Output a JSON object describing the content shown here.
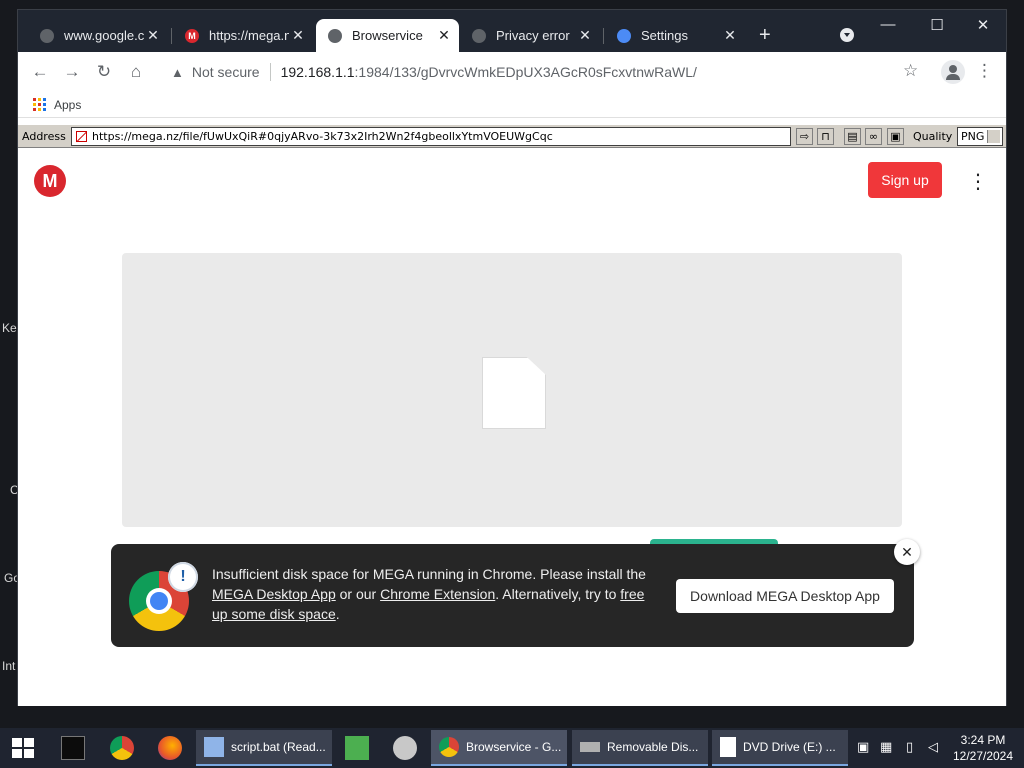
{
  "desktop": {
    "labels": [
      "Ke",
      "C",
      "Go",
      "Int"
    ]
  },
  "browser": {
    "tabs": [
      {
        "title": "www.google.co",
        "icon": "globe-icon",
        "active": false
      },
      {
        "title": "https://mega.n",
        "icon": "mega-favicon",
        "active": false
      },
      {
        "title": "Browservice",
        "icon": "globe-icon",
        "active": true
      },
      {
        "title": "Privacy error",
        "icon": "globe-icon",
        "active": false
      },
      {
        "title": "Settings",
        "icon": "gear-icon",
        "active": false
      }
    ],
    "new_tab_label": "+",
    "window_controls": {
      "minimize": "—",
      "maximize": "☐",
      "close": "✕"
    },
    "address": {
      "security_label": "Not secure",
      "host": "192.168.1.1",
      "path": ":1984/133/gDvrvcWmkEDpUX3AGcR0sFcxvtnwRaWL/"
    },
    "bookmarks": {
      "apps_label": "Apps"
    }
  },
  "browservice_bar": {
    "address_label": "Address",
    "url": "https://mega.nz/file/fUwUxQiR#0qjyARvo-3k73x2Irh2Wn2f4gbeollxYtmVOEUWgCqc",
    "quality_label": "Quality",
    "quality_value": "PNG"
  },
  "page": {
    "logo_letter": "M",
    "signup_label": "Sign up",
    "menu_glyph": "⋮",
    "notification": {
      "badge": "!",
      "message_parts": [
        {
          "text": "Insufficient disk space for MEGA running in Chrome. Please install the ",
          "link": false
        },
        {
          "text": "MEGA Desktop App",
          "link": true
        },
        {
          "text": " or our ",
          "link": false
        },
        {
          "text": "Chrome Extension",
          "link": true
        },
        {
          "text": ". Alternatively, try to ",
          "link": false
        },
        {
          "text": "free up some disk space",
          "link": true
        },
        {
          "text": ".",
          "link": false
        }
      ],
      "button_label": "Download MEGA Desktop App",
      "close_glyph": "✕"
    }
  },
  "taskbar": {
    "tasks": [
      {
        "label": "script.bat (Read...",
        "icon": "notepad-icon",
        "active": false
      },
      {
        "label": "Browservice - G...",
        "icon": "chrome-icon",
        "active": true
      },
      {
        "label": "Removable Dis...",
        "icon": "drive-icon",
        "active": false
      },
      {
        "label": "DVD Drive (E:) ...",
        "icon": "file-icon",
        "active": false
      }
    ],
    "clock": {
      "time": "3:24 PM",
      "date": "12/27/2024"
    }
  },
  "colors": {
    "titlebar": "#202631",
    "mega_red": "#d9272e",
    "signup_red": "#f0373a",
    "notification_bg": "#262626",
    "taskbar": "#1f2430"
  }
}
